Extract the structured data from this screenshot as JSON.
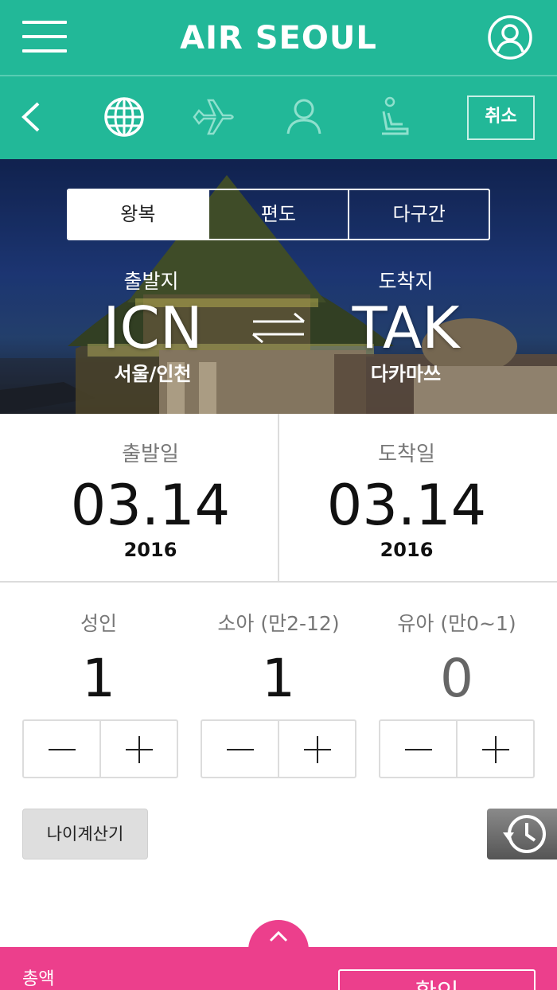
{
  "header": {
    "brand": "AIR SEOUL",
    "menu_icon": "hamburger-menu-icon",
    "profile_icon": "user-circle-icon",
    "bg_color": "#22b898"
  },
  "steps": {
    "back_icon": "chevron-left-icon",
    "items": [
      {
        "icon": "globe-icon",
        "active": true
      },
      {
        "icon": "airplane-icon",
        "active": false
      },
      {
        "icon": "person-icon",
        "active": false
      },
      {
        "icon": "seat-icon",
        "active": false
      }
    ],
    "cancel_label": "취소"
  },
  "trip_type": {
    "options": [
      "왕복",
      "편도",
      "다구간"
    ],
    "selected": "왕복"
  },
  "route": {
    "origin_label": "출발지",
    "origin_code": "ICN",
    "origin_city": "서울/인천",
    "destination_label": "도착지",
    "destination_code": "TAK",
    "destination_city": "다카마쓰",
    "swap_icon": "swap-arrows-icon"
  },
  "dates": {
    "departure_label": "출발일",
    "departure_date": "03.14",
    "departure_year": "2016",
    "arrival_label": "도착일",
    "arrival_date": "03.14",
    "arrival_year": "2016"
  },
  "passengers": [
    {
      "label": "성인",
      "count": "1"
    },
    {
      "label": "소아 (만2-12)",
      "count": "1"
    },
    {
      "label": "유아 (만0~1)",
      "count": "0"
    }
  ],
  "age_calculator_label": "나이계산기",
  "history_icon": "history-icon",
  "footer": {
    "expand_icon": "chevron-up-icon",
    "total_label": "총액",
    "confirm_label": "확인",
    "bg_color": "#ec3f8c"
  }
}
